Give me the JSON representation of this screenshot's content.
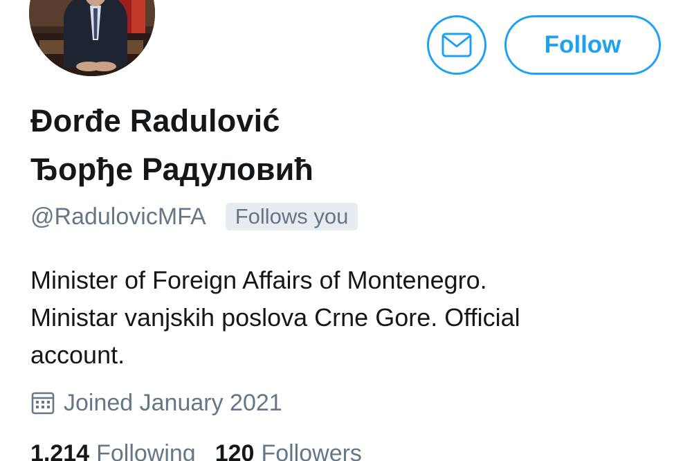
{
  "profile": {
    "name_latin": "Đorđe Radulović",
    "name_cyrillic": "Ђорђе Радуловић",
    "handle": "@RadulovicMFA",
    "follows_you_badge": "Follows you",
    "bio_lines": [
      "Minister of Foreign Affairs of Montenegro.",
      "Ministar vanjskih poslova Crne Gore. Official",
      "account."
    ],
    "joined": "Joined January 2021"
  },
  "actions": {
    "message_icon": "envelope-icon",
    "follow_label": "Follow"
  },
  "stats": {
    "following_count": "1,214",
    "following_label": "Following",
    "followers_count": "120",
    "followers_label": "Followers"
  },
  "icons": {
    "joined_icon": "calendar-icon"
  },
  "colors": {
    "accent": "#1da1f2",
    "text_primary": "#14171a",
    "text_secondary": "#657786",
    "badge_background": "#e6ecf0"
  }
}
